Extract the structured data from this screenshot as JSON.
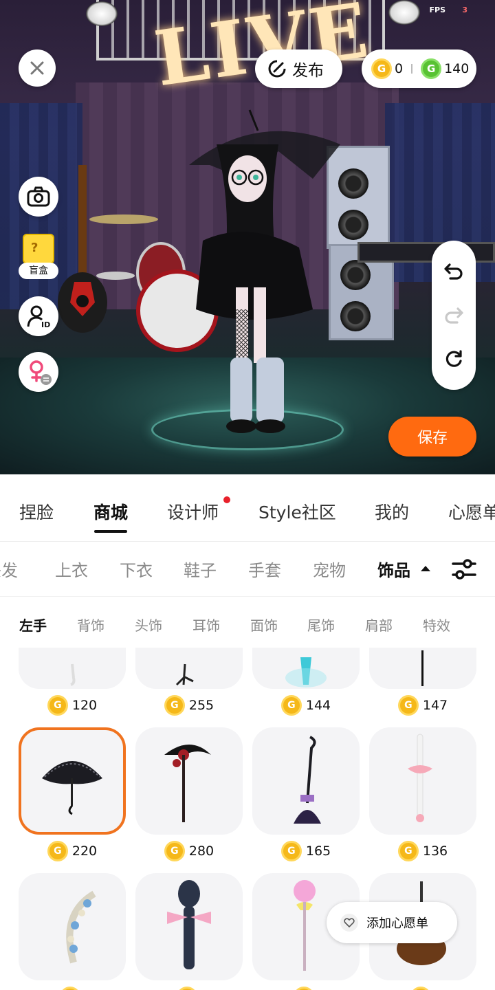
{
  "hud": {
    "fps_label": "FPS",
    "fps_value": "3"
  },
  "stage": {
    "sign_text": "LIVE"
  },
  "top_bar": {
    "close_icon": "close-icon",
    "publish_label": "发布",
    "gold_balance": "0",
    "green_balance": "140",
    "coin_glyph": "G"
  },
  "left_controls": {
    "camera_icon": "camera-icon",
    "blind_box_label": "盲盒",
    "id_icon": "avatar-id-icon",
    "gender_icon": "female-switch-icon"
  },
  "right_controls": {
    "undo_icon": "undo-icon",
    "redo_icon": "redo-icon",
    "reset_icon": "reset-icon"
  },
  "save_label": "保存",
  "main_tabs": [
    "捏脸",
    "商城",
    "设计师",
    "Style社区",
    "我的",
    "心愿单"
  ],
  "main_tab_active": "商城",
  "category_tabs": [
    "头发",
    "上衣",
    "下衣",
    "鞋子",
    "手套",
    "宠物",
    "饰品"
  ],
  "category_active": "饰品",
  "sub_tabs": [
    "左手",
    "背饰",
    "头饰",
    "耳饰",
    "面饰",
    "尾饰",
    "肩部",
    "特效"
  ],
  "sub_active": "左手",
  "items": [
    {
      "name": "白色长剑",
      "price": "120"
    },
    {
      "name": "树枝",
      "price": "255"
    },
    {
      "name": "蓝色冰晶",
      "price": "144"
    },
    {
      "name": "黑色长杖",
      "price": "147"
    },
    {
      "name": "黑色蕾丝伞",
      "price": "220"
    },
    {
      "name": "玫瑰镰刀",
      "price": "280"
    },
    {
      "name": "魔女扫帚",
      "price": "165"
    },
    {
      "name": "粉色蝴蝶结棒",
      "price": "136"
    },
    {
      "name": "花环",
      "price": ""
    },
    {
      "name": "麦克风",
      "price": ""
    },
    {
      "name": "棒棒糖",
      "price": ""
    },
    {
      "name": "怀表",
      "price": ""
    }
  ],
  "wishlist_button_label": "添加心愿单",
  "colors": {
    "accent": "#ff6a10",
    "selected_border": "#f0731f",
    "notify_dot": "#e8212b",
    "gold_coin": "#f5b819",
    "green_coin": "#58c233"
  }
}
